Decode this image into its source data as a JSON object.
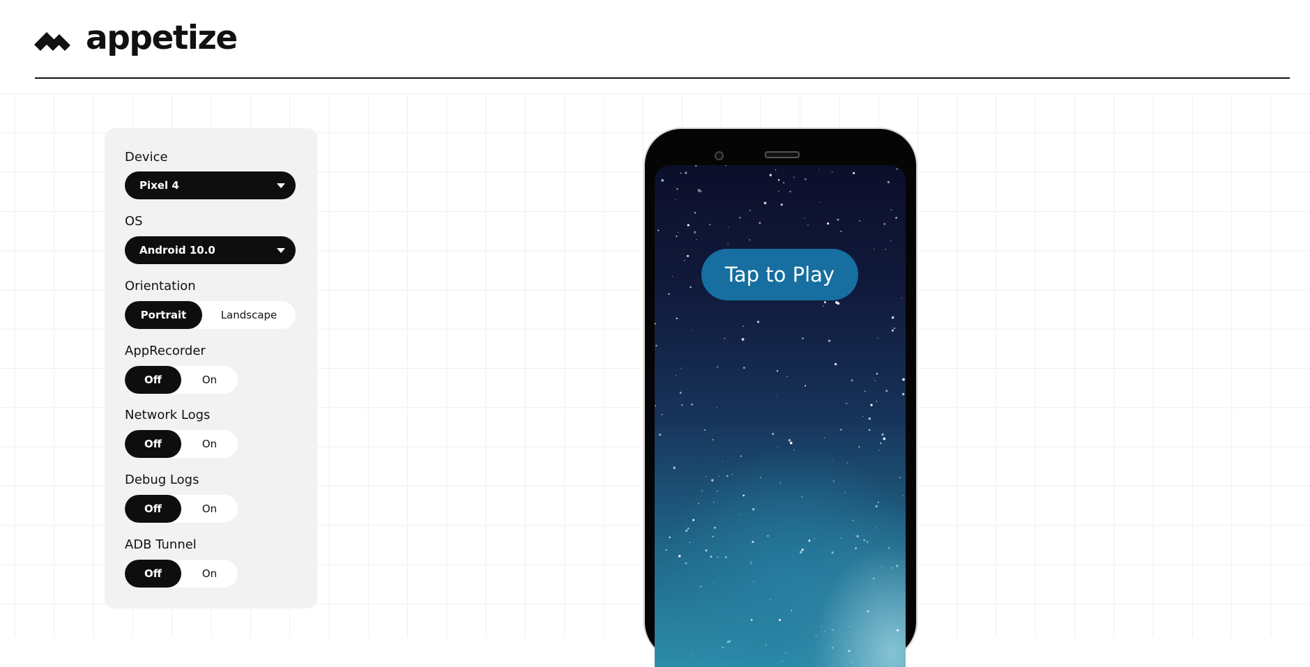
{
  "brand": {
    "name": "appetize",
    "logo_icon": "appetize-logo-icon"
  },
  "panel": {
    "device": {
      "label": "Device",
      "value": "Pixel 4"
    },
    "os": {
      "label": "OS",
      "value": "Android 10.0"
    },
    "orientation": {
      "label": "Orientation",
      "options": [
        "Portrait",
        "Landscape"
      ],
      "selected": "Portrait"
    },
    "app_recorder": {
      "label": "AppRecorder",
      "options": [
        "Off",
        "On"
      ],
      "selected": "Off"
    },
    "network_logs": {
      "label": "Network Logs",
      "options": [
        "Off",
        "On"
      ],
      "selected": "Off"
    },
    "debug_logs": {
      "label": "Debug Logs",
      "options": [
        "Off",
        "On"
      ],
      "selected": "Off"
    },
    "adb_tunnel": {
      "label": "ADB Tunnel",
      "options": [
        "Off",
        "On"
      ],
      "selected": "Off"
    }
  },
  "device_screen": {
    "tap_to_play": "Tap to Play"
  },
  "colors": {
    "accent": "#0e0e0e",
    "panel_bg": "#f2f2f2",
    "play_button": "#166fa0"
  }
}
